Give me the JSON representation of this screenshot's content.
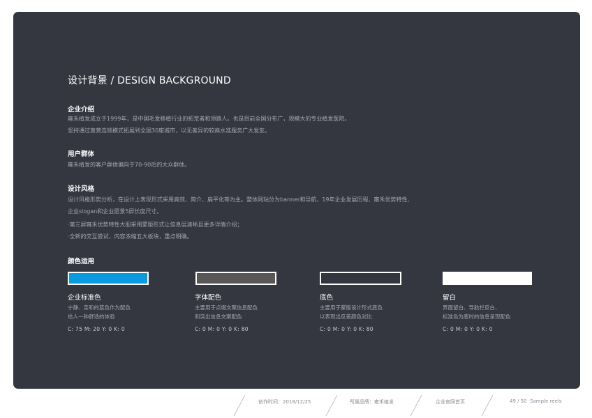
{
  "page": {
    "title": "设计背景 / DESIGN BACKGROUND"
  },
  "sections": {
    "company": {
      "heading": "企业介绍",
      "lines": [
        "雍禾植发成立于1999年，是中国毛发移植行业的拓荒者和领路人。也是目前全国分布广，规模大的专业植发医院。",
        "坚持通过直营连锁模式拓展到全国30座城市，以无差异的较高水准服务广大发友。"
      ]
    },
    "users": {
      "heading": "用户群体",
      "lines": [
        "雍禾植发的客户群体偏向于70-90后的大众群体。"
      ]
    },
    "style": {
      "heading": "设计风格",
      "lines": [
        "设计风格形势分析，在设计上表现形式采用高效、简介、扁平化等为主。整体网站分为banner和导航、19年企业发展历程、雍禾优势特性、",
        "企业slogan和企业愿景5屏长度尺寸。",
        "·第三屏雍禾优势特性大胆采用蒙版形式让信息层清晰且更多详情介绍；",
        "·全新的交互尝试，内容浓缩五大板块，重点明确。"
      ]
    },
    "colors": {
      "heading": "颜色运用",
      "items": [
        {
          "name": "企业标准色",
          "desc": [
            "宁静、亲和的蓝色作为配色",
            "给人一种舒适的体验"
          ],
          "cmyk": "C: 75  M: 20  Y: 0  K: 0",
          "color": "#0a9adf",
          "border": "#ffffff"
        },
        {
          "name": "字体配色",
          "desc": [
            "主要用于点缀文案信息配色",
            "和突出信息文案配色"
          ],
          "cmyk": "C: 0  M: 0  Y: 0  K: 80",
          "color": "#595757",
          "border": "#ffffff"
        },
        {
          "name": "底色",
          "desc": [
            "主要用于蒙版设计形式底色",
            "以表现出反差颜色对比"
          ],
          "cmyk": "C: 0  M: 0  Y: 0  K: 80",
          "color": "#343740",
          "border": "#ffffff"
        },
        {
          "name": "留白",
          "desc": [
            "界面留白、导航栏反白、",
            "标准色为底时的信息呈现配色"
          ],
          "cmyk": "C: 0  M: 0  Y: 0  K: 0",
          "color": "#ffffff",
          "border": "#ffffff"
        }
      ]
    }
  },
  "footer": {
    "created": "创作时间：2018/12/25",
    "brand": "所属品牌：雍禾植发",
    "page_type": "企业官网首页",
    "page_number": "49 / 50",
    "reel": "Sample reels"
  },
  "colors": {
    "panel_background": "#343740",
    "heading_text": "#ffffff",
    "body_text": "#a3a6ad",
    "footer_text": "#8a8d94"
  }
}
